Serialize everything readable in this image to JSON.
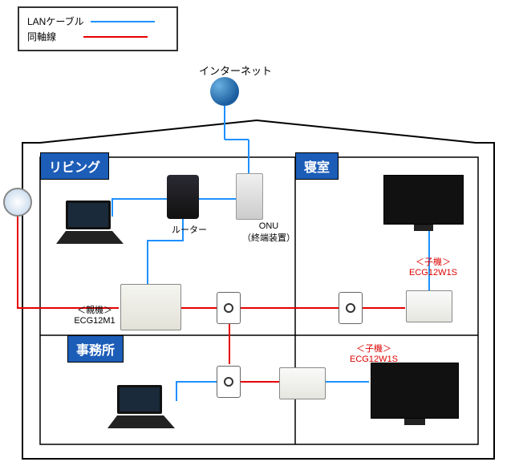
{
  "legend": {
    "lan_label": "LANケーブル",
    "coax_label": "同軸線",
    "lan_color": "#1e90ff",
    "coax_color": "#e60000"
  },
  "internet_label": "インターネット",
  "rooms": {
    "living": "リビング",
    "bedroom": "寝室",
    "office": "事務所"
  },
  "devices": {
    "router_label": "ルーター",
    "onu_label": "ONU",
    "onu_sublabel": "（終端装置）",
    "parent_title": "＜親機＞",
    "parent_model": "ECG12M1",
    "child_title": "＜子機＞",
    "child_model": "ECG12W1S"
  }
}
